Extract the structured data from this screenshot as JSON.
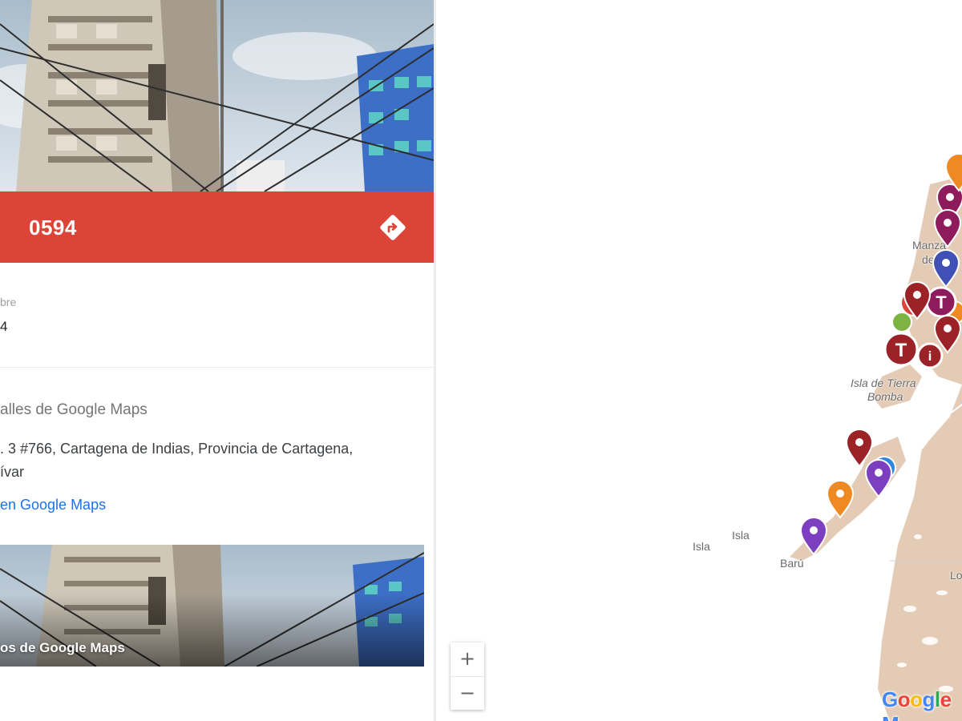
{
  "place": {
    "title": "0594",
    "field_label": "bre",
    "field_value": "4"
  },
  "details": {
    "section_title": "alles de Google Maps",
    "address_line1": ". 3 #766, Cartagena de Indias, Provincia de Cartagena,",
    "address_line2": "ívar",
    "link_label": "en Google Maps",
    "photo_caption": "os de Google Maps"
  },
  "map": {
    "labels": {
      "manzanillo_1": "Manza",
      "manzanillo_2": "del M",
      "tierra_bomba_1": "Isla de Tierra",
      "tierra_bomba_2": "Bomba",
      "isla_1": "Isla",
      "isla_2": "Isla",
      "baru": "Barú",
      "edge": "Lo"
    },
    "zoom_in": "+",
    "zoom_out": "−",
    "logo": [
      "G",
      "o",
      "o",
      "g",
      "l",
      "e",
      " M"
    ]
  },
  "colors": {
    "banner": "#db4437",
    "link": "#1a73e8",
    "land": "#e4cbb6",
    "marker_maroon": "#9b2226",
    "marker_purple": "#8e1b5c",
    "marker_violet": "#7b3fbf",
    "marker_orange": "#ef8a22",
    "marker_blue": "#3f51b5"
  },
  "icons": [
    "directions-icon",
    "map-marker-icon",
    "transit-marker-icon",
    "info-marker-icon"
  ]
}
